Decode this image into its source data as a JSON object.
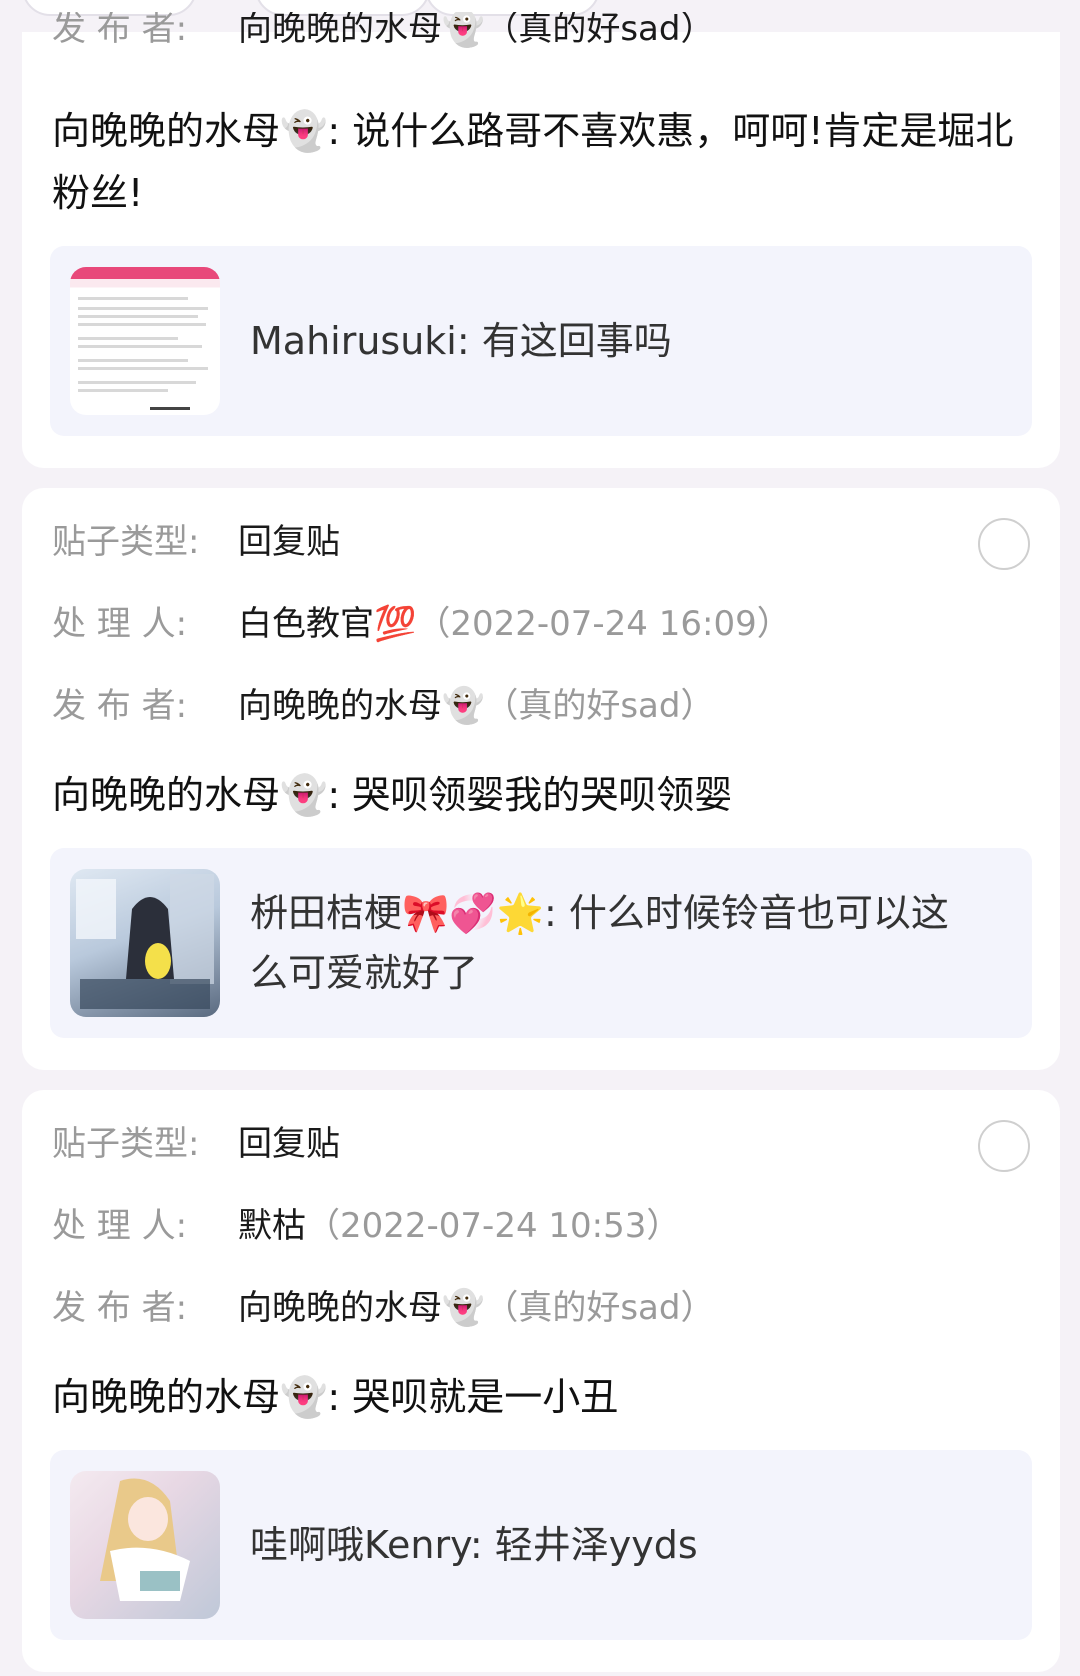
{
  "labels": {
    "type": "贴子类型:",
    "handler": "处 理 人:",
    "publisher": "发 布 者:"
  },
  "cards": [
    {
      "publisher_partial": "向晚晚的水母👻（真的好sad）",
      "content": "向晚晚的水母👻: 说什么路哥不喜欢惠，呵呵!肯定是堀北粉丝!",
      "quote": "Mahirusuki: 有这回事吗"
    },
    {
      "type": "回复贴",
      "handler_name": "白色教官💯",
      "handler_time": "（2022-07-24 16:09）",
      "publisher_name": "向晚晚的水母👻",
      "publisher_note": "（真的好sad）",
      "content": "向晚晚的水母👻: 哭呗领婴我的哭呗领婴",
      "quote": "枡田桔梗🎀💞🌟: 什么时候铃音也可以这么可爱就好了"
    },
    {
      "type": "回复贴",
      "handler_name": "默枯",
      "handler_time": "（2022-07-24 10:53）",
      "publisher_name": "向晚晚的水母👻",
      "publisher_note": "（真的好sad）",
      "content": "向晚晚的水母👻: 哭呗就是一小丑",
      "quote": "哇啊哦Kenry: 轻井泽yyds"
    }
  ]
}
